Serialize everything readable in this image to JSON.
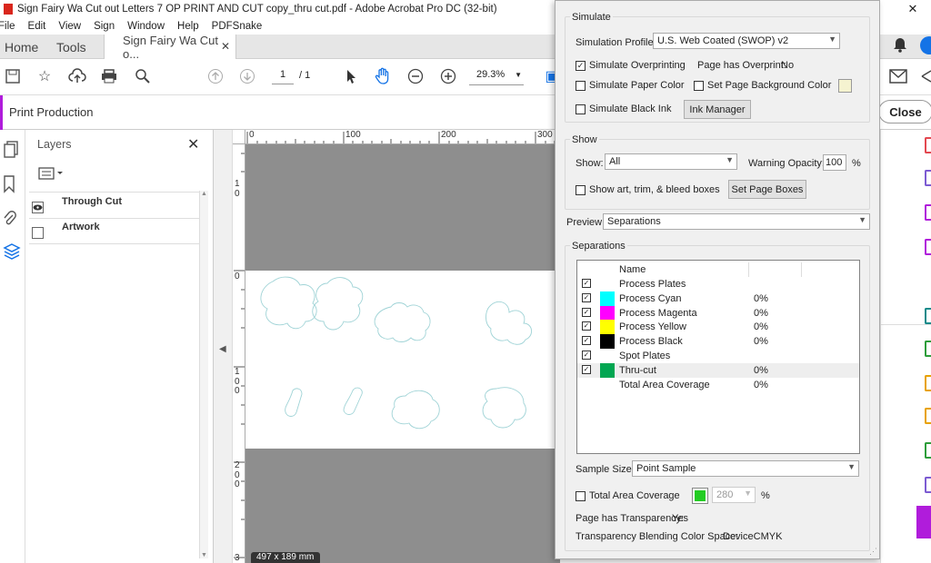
{
  "window": {
    "title": "Sign Fairy Wa Cut out Letters 7  OP PRINT AND CUT copy_thru cut.pdf - Adobe Acrobat Pro DC (32-bit)",
    "close_glyph": "✕"
  },
  "menu": [
    "File",
    "Edit",
    "View",
    "Sign",
    "Window",
    "Help",
    "PDFSnake"
  ],
  "tabs": {
    "home": "Home",
    "tools": "Tools",
    "doc": "Sign Fairy Wa Cut o..."
  },
  "toolbar": {
    "page_current": "1",
    "page_total": "/ 1",
    "zoom": "29.3%"
  },
  "print_production": {
    "title": "Print Production",
    "close_label": "Close"
  },
  "layers": {
    "header": "Layers",
    "items": [
      {
        "label": "Through Cut",
        "visible": true
      },
      {
        "label": "Artwork",
        "visible": false
      }
    ]
  },
  "rulers": {
    "h": [
      "0",
      "100",
      "200",
      "300"
    ],
    "v": [
      "1",
      "0",
      "0",
      "1",
      "0",
      "0",
      "2",
      "0",
      "0",
      "3"
    ]
  },
  "doc": {
    "size_badge": "497 x 189 mm"
  },
  "dialog": {
    "simulate": {
      "title": "Simulate",
      "profile_label": "Simulation Profile:",
      "profile_value": "U.S. Web Coated (SWOP) v2",
      "overprint_label": "Simulate Overprinting",
      "overprint_checked": true,
      "has_overprint_label": "Page has Overprint:",
      "has_overprint_value": "No",
      "paper_color_label": "Simulate Paper Color",
      "bg_color_label": "Set Page Background Color",
      "black_ink_label": "Simulate Black Ink",
      "ink_manager_label": "Ink Manager"
    },
    "show": {
      "title": "Show",
      "show_label": "Show:",
      "show_value": "All",
      "warning_label": "Warning Opacity:",
      "warning_value": "100",
      "warning_unit": "%",
      "boxes_label": "Show art, trim, & bleed boxes",
      "page_boxes_label": "Set Page Boxes"
    },
    "preview": {
      "label": "Preview:",
      "value": "Separations"
    },
    "separations": {
      "title": "Separations",
      "column_name": "Name",
      "rows": [
        {
          "name": "Process Plates",
          "pct": "",
          "checked": true,
          "color": ""
        },
        {
          "name": "Process Cyan",
          "pct": "0%",
          "checked": true,
          "color": "#00ffff"
        },
        {
          "name": "Process Magenta",
          "pct": "0%",
          "checked": true,
          "color": "#ff00ff"
        },
        {
          "name": "Process Yellow",
          "pct": "0%",
          "checked": true,
          "color": "#ffff00"
        },
        {
          "name": "Process Black",
          "pct": "0%",
          "checked": true,
          "color": "#000000"
        },
        {
          "name": "Spot Plates",
          "pct": "",
          "checked": true,
          "color": ""
        },
        {
          "name": "Thru-cut",
          "pct": "0%",
          "checked": true,
          "color": "#00a651"
        },
        {
          "name": "Total Area Coverage",
          "pct": "0%",
          "checked": false,
          "color": ""
        }
      ]
    },
    "sample_size": {
      "label": "Sample Size:",
      "value": "Point Sample"
    },
    "tac": {
      "label": "Total Area Coverage",
      "value": "280",
      "unit": "%",
      "color": "#22cc22"
    },
    "transparency": {
      "label": "Page has Transparency:",
      "value": "Yes"
    },
    "blend": {
      "label": "Transparency Blending Color Space:",
      "value": "DeviceCMYK"
    }
  },
  "colors": {
    "accent": "#1473e6",
    "rail_purple": "#b01cdb"
  }
}
